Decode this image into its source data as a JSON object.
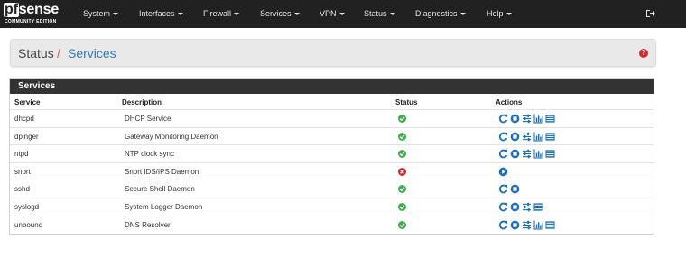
{
  "nav": {
    "logo_main_pf": "pf",
    "logo_main_rest": "sense",
    "logo_sub": "COMMUNITY EDITION",
    "items": [
      {
        "label": "System"
      },
      {
        "label": "Interfaces"
      },
      {
        "label": "Firewall"
      },
      {
        "label": "Services"
      },
      {
        "label": "VPN"
      },
      {
        "label": "Status"
      },
      {
        "label": "Diagnostics"
      },
      {
        "label": "Help"
      }
    ],
    "logout_icon": "sign-out-icon"
  },
  "breadcrumb": {
    "section": "Status",
    "separator": "/",
    "page": "Services",
    "help_label": "?"
  },
  "panel": {
    "title": "Services",
    "columns": [
      "Service",
      "Description",
      "Status",
      "Actions"
    ],
    "rows": [
      {
        "service": "dhcpd",
        "description": "DHCP Service",
        "status": "running",
        "actions": [
          "restart",
          "stop",
          "settings",
          "graph",
          "logs"
        ]
      },
      {
        "service": "dpinger",
        "description": "Gateway Monitoring Daemon",
        "status": "running",
        "actions": [
          "restart",
          "stop",
          "settings",
          "graph",
          "logs"
        ]
      },
      {
        "service": "ntpd",
        "description": "NTP clock sync",
        "status": "running",
        "actions": [
          "restart",
          "stop",
          "settings",
          "graph",
          "logs"
        ]
      },
      {
        "service": "snort",
        "description": "Snort IDS/IPS Daemon",
        "status": "stopped",
        "actions": [
          "start"
        ]
      },
      {
        "service": "sshd",
        "description": "Secure Shell Daemon",
        "status": "running",
        "actions": [
          "restart",
          "stop"
        ]
      },
      {
        "service": "syslogd",
        "description": "System Logger Daemon",
        "status": "running",
        "actions": [
          "restart",
          "stop",
          "settings",
          "logs"
        ]
      },
      {
        "service": "unbound",
        "description": "DNS Resolver",
        "status": "running",
        "actions": [
          "restart",
          "stop",
          "settings",
          "graph",
          "logs"
        ]
      }
    ]
  },
  "colors": {
    "nav_bg": "#212121",
    "link": "#337ab7",
    "ok": "#3dae49",
    "error": "#d9262b",
    "action": "#1f6fb8"
  }
}
